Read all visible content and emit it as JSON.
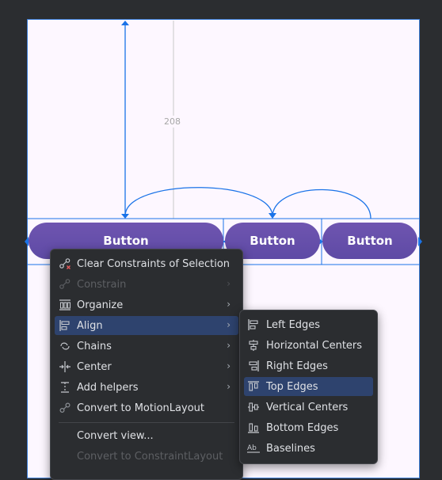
{
  "canvas": {
    "dimension_label": "208",
    "buttons": [
      {
        "label": "Button"
      },
      {
        "label": "Button"
      },
      {
        "label": "Button"
      }
    ]
  },
  "context_menu": {
    "items": [
      {
        "label": "Clear Constraints of Selection",
        "icon": "clear-constraints-icon",
        "enabled": true,
        "submenu": false
      },
      {
        "label": "Constrain",
        "icon": "constrain-icon",
        "enabled": false,
        "submenu": true
      },
      {
        "label": "Organize",
        "icon": "organize-icon",
        "enabled": true,
        "submenu": true
      },
      {
        "label": "Align",
        "icon": "align-icon",
        "enabled": true,
        "submenu": true,
        "highlighted": true
      },
      {
        "label": "Chains",
        "icon": "chains-icon",
        "enabled": true,
        "submenu": true
      },
      {
        "label": "Center",
        "icon": "center-icon",
        "enabled": true,
        "submenu": true
      },
      {
        "label": "Add helpers",
        "icon": "add-helpers-icon",
        "enabled": true,
        "submenu": true
      },
      {
        "label": "Convert to MotionLayout",
        "icon": "motionlayout-icon",
        "enabled": true,
        "submenu": false
      },
      {
        "label": "Convert view...",
        "icon": "",
        "enabled": true,
        "submenu": false
      },
      {
        "label": "Convert to ConstraintLayout",
        "icon": "",
        "enabled": false,
        "submenu": false
      }
    ]
  },
  "align_submenu": {
    "items": [
      {
        "label": "Left Edges",
        "icon": "align-left-edges-icon"
      },
      {
        "label": "Horizontal Centers",
        "icon": "align-horizontal-centers-icon"
      },
      {
        "label": "Right Edges",
        "icon": "align-right-edges-icon"
      },
      {
        "label": "Top Edges",
        "icon": "align-top-edges-icon",
        "highlighted": true
      },
      {
        "label": "Vertical Centers",
        "icon": "align-vertical-centers-icon"
      },
      {
        "label": "Bottom Edges",
        "icon": "align-bottom-edges-icon"
      },
      {
        "label": "Baselines",
        "icon": "align-baselines-icon"
      }
    ]
  },
  "colors": {
    "background": "#2b2d30",
    "canvas": "#fdf7ff",
    "button": "#6750a4",
    "constraint_blue": "#1a73e8",
    "menu_highlight": "#2e436e"
  }
}
